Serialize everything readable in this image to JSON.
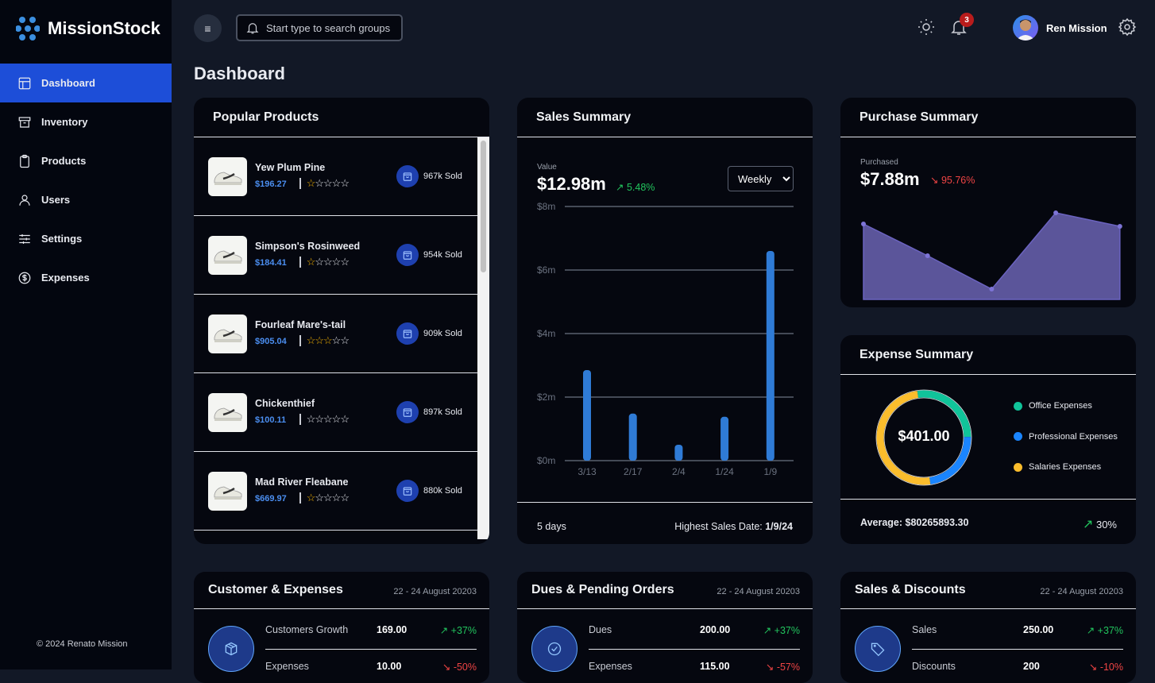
{
  "app": {
    "name": "MissionStock",
    "copyright": "© 2024 Renato Mission"
  },
  "sidebar": {
    "items": [
      {
        "label": "Dashboard",
        "icon": "layout-icon",
        "active": true
      },
      {
        "label": "Inventory",
        "icon": "archive-icon"
      },
      {
        "label": "Products",
        "icon": "clipboard-icon"
      },
      {
        "label": "Users",
        "icon": "user-icon"
      },
      {
        "label": "Settings",
        "icon": "sliders-icon"
      },
      {
        "label": "Expenses",
        "icon": "dollar-circle-icon"
      }
    ]
  },
  "header": {
    "search_placeholder": "Start type to search groups",
    "notification_count": "3",
    "user_name": "Ren Mission"
  },
  "page_title": "Dashboard",
  "popular": {
    "title": "Popular Products",
    "products": [
      {
        "name": "Yew Plum Pine",
        "price": "$196.27",
        "rating": 1,
        "sold": "967k Sold"
      },
      {
        "name": "Simpson's Rosinweed",
        "price": "$184.41",
        "rating": 1,
        "sold": "954k Sold"
      },
      {
        "name": "Fourleaf Mare's-tail",
        "price": "$905.04",
        "rating": 3,
        "sold": "909k Sold"
      },
      {
        "name": "Chickenthief",
        "price": "$100.11",
        "rating": 0,
        "sold": "897k Sold"
      },
      {
        "name": "Mad River Fleabane",
        "price": "$669.97",
        "rating": 1,
        "sold": "880k Sold"
      }
    ]
  },
  "sales": {
    "title": "Sales Summary",
    "value_label": "Value",
    "value": "$12.98m",
    "change": "5.48%",
    "period": "Weekly",
    "days": "5 days",
    "highest_label": "Highest Sales Date:",
    "highest_date": "1/9/24"
  },
  "purchase": {
    "title": "Purchase Summary",
    "label": "Purchased",
    "value": "$7.88m",
    "change": "95.76%"
  },
  "expense": {
    "title": "Expense Summary",
    "total": "$401.00",
    "average": "Average: $80265893.30",
    "change": "30%"
  },
  "chart_data": [
    {
      "type": "bar",
      "categories": [
        "3/13",
        "2/17",
        "2/4",
        "1/24",
        "1/9"
      ],
      "values": [
        2.85,
        1.48,
        0.5,
        1.38,
        6.6
      ],
      "ylim": [
        0,
        8
      ],
      "yticks": [
        "$0m",
        "$2m",
        "$4m",
        "$6m",
        "$8m"
      ],
      "grid": true,
      "color": "#2f7bd6"
    },
    {
      "type": "area",
      "values": [
        95,
        55,
        13,
        109,
        92
      ],
      "color": "#5b559a"
    },
    {
      "type": "pie",
      "donut": true,
      "labels": [
        "Office Expenses",
        "Professional Expenses",
        "Salaries Expenses"
      ],
      "values": [
        27,
        23,
        50
      ],
      "colors": [
        "#10c49a",
        "#1a85ff",
        "#fbbd2c"
      ],
      "legend": "right"
    }
  ],
  "bottom": [
    {
      "title": "Customer & Expenses",
      "date": "22 - 24 August 20203",
      "icon": "package-icon",
      "rows": [
        {
          "k": "Customers Growth",
          "v": "169.00",
          "p": "+37%",
          "up": true
        },
        {
          "k": "Expenses",
          "v": "10.00",
          "p": "-50%",
          "up": false
        }
      ]
    },
    {
      "title": "Dues & Pending Orders",
      "date": "22 - 24 August 20203",
      "icon": "check-circle-icon",
      "rows": [
        {
          "k": "Dues",
          "v": "200.00",
          "p": "+37%",
          "up": true
        },
        {
          "k": "Expenses",
          "v": "115.00",
          "p": "-57%",
          "up": false
        }
      ]
    },
    {
      "title": "Sales & Discounts",
      "date": "22 - 24 August 20203",
      "icon": "tag-icon",
      "rows": [
        {
          "k": "Sales",
          "v": "250.00",
          "p": "+37%",
          "up": true
        },
        {
          "k": "Discounts",
          "v": "200",
          "p": "-10%",
          "up": false
        }
      ]
    }
  ]
}
